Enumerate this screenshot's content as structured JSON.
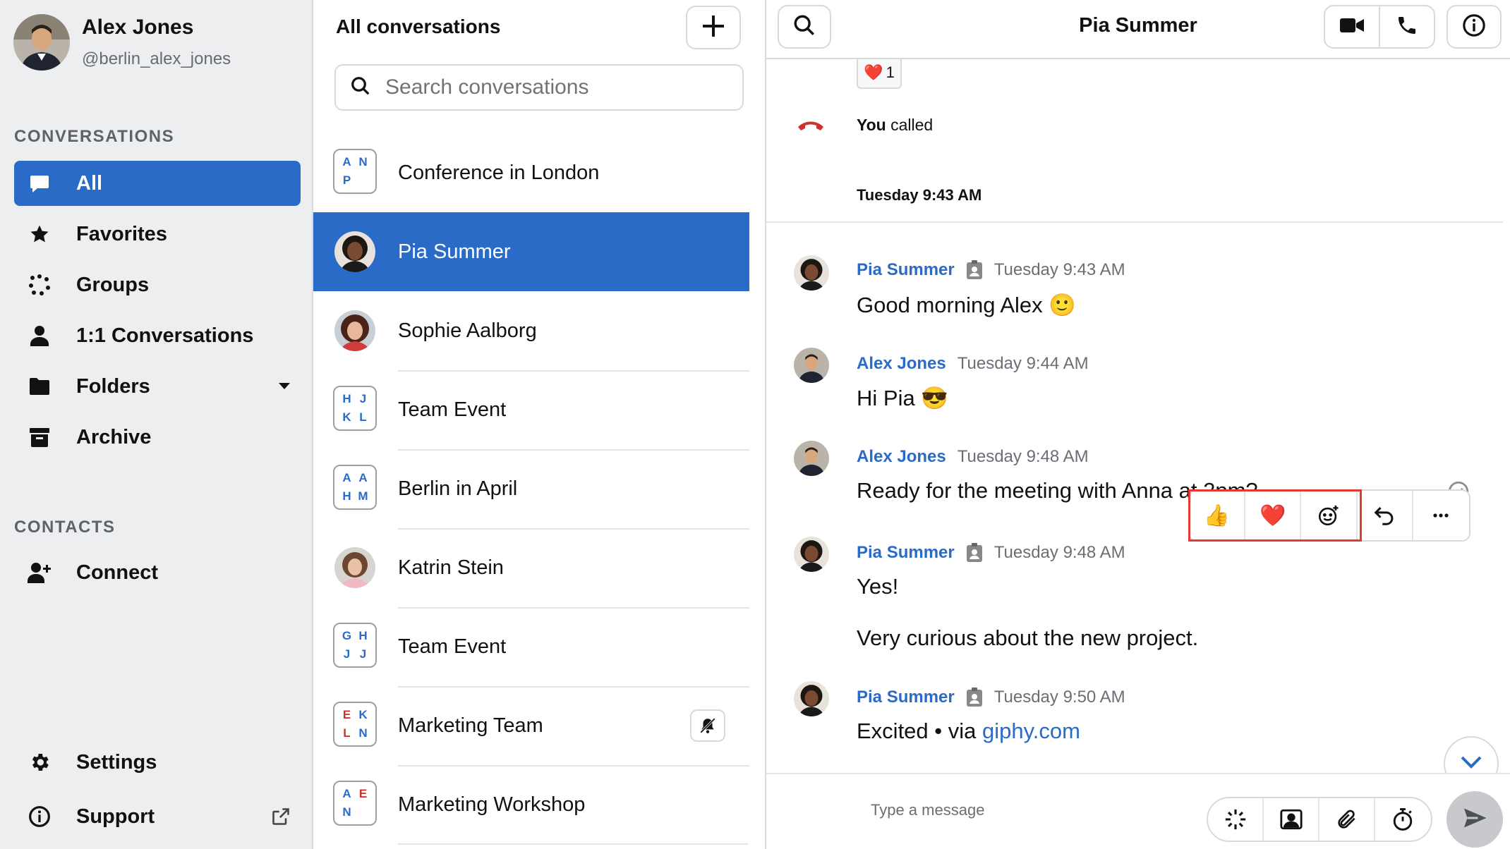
{
  "profile": {
    "name": "Alex Jones",
    "handle": "@berlin_alex_jones"
  },
  "sidebar": {
    "conversations_title": "CONVERSATIONS",
    "items": [
      {
        "label": "All",
        "icon": "chat-bubble-icon",
        "active": true
      },
      {
        "label": "Favorites",
        "icon": "star-icon"
      },
      {
        "label": "Groups",
        "icon": "groups-dots-icon"
      },
      {
        "label": "1:1 Conversations",
        "icon": "person-icon"
      },
      {
        "label": "Folders",
        "icon": "folder-icon"
      },
      {
        "label": "Archive",
        "icon": "archive-icon"
      }
    ],
    "contacts_title": "CONTACTS",
    "connect_label": "Connect",
    "settings_label": "Settings",
    "support_label": "Support"
  },
  "list": {
    "title": "All conversations",
    "search_placeholder": "Search conversations",
    "conversations": [
      {
        "name": "Conference in London",
        "type": "group",
        "initials": [
          "A",
          "N",
          "P",
          ""
        ],
        "colors": [
          "#2b6bc8",
          "#2b6bc8",
          "#2b6bc8",
          ""
        ]
      },
      {
        "name": "Pia Summer",
        "type": "person",
        "active": true
      },
      {
        "name": "Sophie Aalborg",
        "type": "person"
      },
      {
        "name": "Team Event",
        "type": "group",
        "initials": [
          "H",
          "J",
          "K",
          "L"
        ],
        "colors": [
          "#2b6bc8",
          "#2b6bc8",
          "#2b6bc8",
          "#2b6bc8"
        ]
      },
      {
        "name": "Berlin in April",
        "type": "group",
        "initials": [
          "A",
          "A",
          "H",
          "M"
        ],
        "colors": [
          "#2b6bc8",
          "#2b6bc8",
          "#2b6bc8",
          "#2b6bc8"
        ]
      },
      {
        "name": "Katrin Stein",
        "type": "person"
      },
      {
        "name": "Team Event",
        "type": "group",
        "initials": [
          "G",
          "H",
          "J",
          "J"
        ],
        "colors": [
          "#2b6bc8",
          "#2b6bc8",
          "#2b6bc8",
          "#2b6bc8"
        ]
      },
      {
        "name": "Marketing Team",
        "type": "group",
        "initials": [
          "E",
          "K",
          "L",
          "N"
        ],
        "colors": [
          "#d0312d",
          "#2b6bc8",
          "#d0312d",
          "#2b6bc8"
        ],
        "muted": true
      },
      {
        "name": "Marketing Workshop",
        "type": "group",
        "initials": [
          "A",
          "E",
          "N",
          ""
        ],
        "colors": [
          "#2b6bc8",
          "#d0312d",
          "#2b6bc8",
          ""
        ]
      }
    ]
  },
  "chat": {
    "title": "Pia Summer",
    "reaction_count": "1",
    "call_you": "You",
    "call_text": "called",
    "date_label": "Tuesday 9:43 AM",
    "messages": [
      {
        "author": "Pia Summer",
        "time": "Tuesday 9:43 AM",
        "text": "Good morning Alex 🙂",
        "badge": true
      },
      {
        "author": "Alex Jones",
        "time": "Tuesday 9:44 AM",
        "text": "Hi Pia 😎"
      },
      {
        "author": "Alex Jones",
        "time": "Tuesday 9:48 AM",
        "text": "Ready for the meeting with Anna at 2pm?"
      },
      {
        "author": "Pia Summer",
        "time": "Tuesday 9:48 AM",
        "text": "Yes!",
        "badge": true
      },
      {
        "text": "Very curious about the new project."
      },
      {
        "author": "Pia Summer",
        "time": "Tuesday 9:50 AM",
        "text": "Excited • via ",
        "link": "giphy.com",
        "badge": true
      }
    ],
    "composer_placeholder": "Type a message"
  },
  "colors": {
    "accent": "#2b6bc8",
    "highlight_box": "#e33a33"
  }
}
